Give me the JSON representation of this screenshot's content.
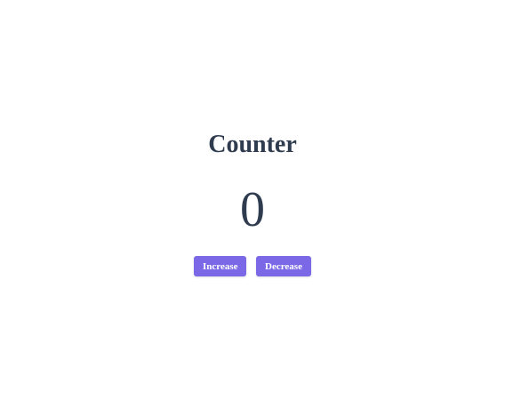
{
  "counter": {
    "title": "Counter",
    "value": "0",
    "increase_label": "Increase",
    "decrease_label": "Decrease"
  },
  "colors": {
    "text": "#2f3b4f",
    "button": "#7b68e6",
    "button_text": "#ffffff",
    "background": "#ffffff"
  }
}
